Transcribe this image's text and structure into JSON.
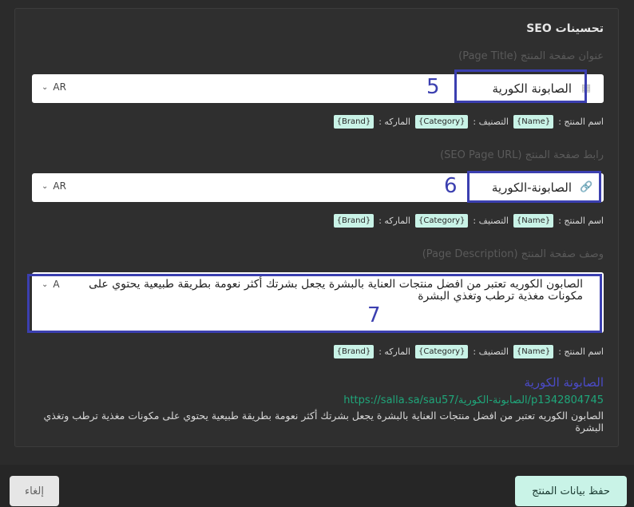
{
  "section_title": "تحسينات SEO",
  "page_title": {
    "label": "عنوان صفحة المنتج (Page Title)",
    "value": "الصابونة الكورية",
    "lang": "AR",
    "callout": "5"
  },
  "page_url": {
    "label": "رابط صفحة المنتج (SEO Page URL)",
    "value": "الصابونة-الكورية",
    "lang": "AR",
    "callout": "6"
  },
  "page_description": {
    "label": "وصف صفحة المنتج (Page Description)",
    "value": "الصابون الكوريه تعتبر من افضل منتجات العناية بالبشرة  يجعل بشرتك أكثر نعومة بطريقة طبيعية يحتوي على مكونات مغذية ترطب وتغذي البشرة",
    "lang": "A",
    "callout": "7"
  },
  "tags": {
    "product_name_label": "اسم المنتج :",
    "name_tag": "{Name}",
    "category_label": "التصنيف :",
    "category_tag": "{Category}",
    "brand_label": "الماركه :",
    "brand_tag": "{Brand}"
  },
  "preview": {
    "title": "الصابونة الكورية",
    "url": "https://salla.sa/sau57/الصابونة-الكورية/p1342804745",
    "description": "الصابون الكوريه تعتبر من افضل منتجات العناية بالبشرة يجعل بشرتك أكثر نعومة بطريقة طبيعية يحتوي على مكونات مغذية ترطب وتغذي البشرة"
  },
  "footer": {
    "save_label": "حفظ بيانات المنتج",
    "cancel_label": "إلغاء"
  },
  "colors": {
    "highlight": "#3b3fb0",
    "tag_bg": "#c9f3e7",
    "url_green": "#1fa67a",
    "preview_title": "#4b4bc8"
  }
}
